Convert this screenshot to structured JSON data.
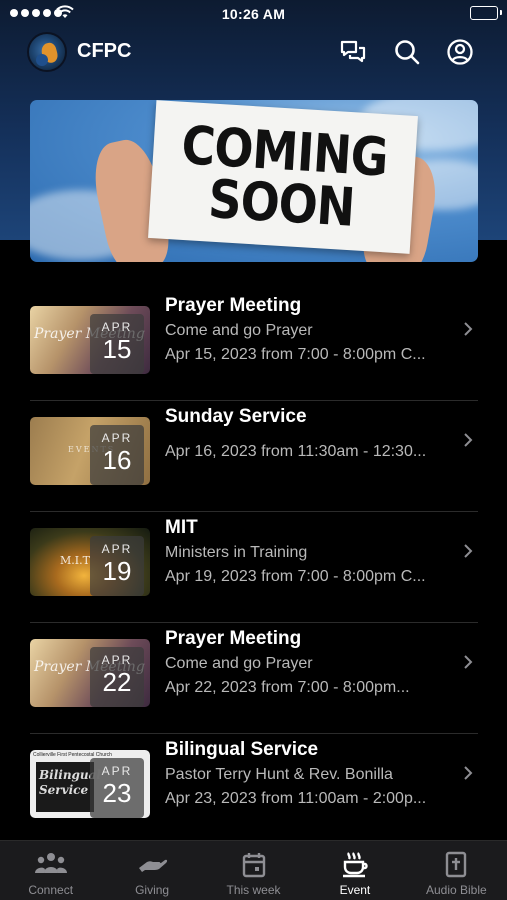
{
  "status_bar": {
    "time": "10:26 AM"
  },
  "app": {
    "title": "CFPC"
  },
  "header_icons": [
    "chat-bubbles-icon",
    "search-icon",
    "profile-icon"
  ],
  "banner": {
    "line1": "COMING",
    "line2": "SOON"
  },
  "events": [
    {
      "title": "Prayer Meeting",
      "subtitle": "Come and go Prayer",
      "date_line": "Apr 15, 2023 from 7:00 - 8:00pm C...",
      "month": "APR",
      "day": "15",
      "thumb_caption": "Prayer Meeting"
    },
    {
      "title": "Sunday Service",
      "subtitle": "",
      "date_line": "Apr 16, 2023 from 11:30am - 12:30...",
      "month": "APR",
      "day": "16",
      "thumb_caption": "EVENTS"
    },
    {
      "title": "MIT",
      "subtitle": "Ministers in Training",
      "date_line": "Apr 19, 2023 from 7:00 - 8:00pm C...",
      "month": "APR",
      "day": "19",
      "thumb_caption": "M.I.T"
    },
    {
      "title": "Prayer Meeting",
      "subtitle": "Come and go Prayer",
      "date_line": "Apr 22, 2023 from 7:00 - 8:00pm...",
      "month": "APR",
      "day": "22",
      "thumb_caption": "Prayer Meeting"
    },
    {
      "title": "Bilingual Service",
      "subtitle": "Pastor Terry Hunt & Rev. Bonilla",
      "date_line": "Apr 23, 2023 from 11:00am - 2:00p...",
      "month": "APR",
      "day": "23",
      "thumb_caption": "Bilingual Service",
      "thumb_header": "Collierville First Pentecostal Church"
    }
  ],
  "tabs": [
    {
      "label": "Connect",
      "icon": "people-icon",
      "active": false
    },
    {
      "label": "Giving",
      "icon": "giving-hand-icon",
      "active": false
    },
    {
      "label": "This week",
      "icon": "calendar-icon",
      "active": false
    },
    {
      "label": "Event",
      "icon": "coffee-cup-icon",
      "active": true
    },
    {
      "label": "Audio Bible",
      "icon": "bible-icon",
      "active": false
    }
  ],
  "colors": {
    "background": "#000000",
    "header_top": "#0d1b31",
    "header_bottom": "#1d4478",
    "secondary_text": "#b9b9b9",
    "tab_inactive": "#8e8e93",
    "tab_bar": "#1b1b1d"
  }
}
